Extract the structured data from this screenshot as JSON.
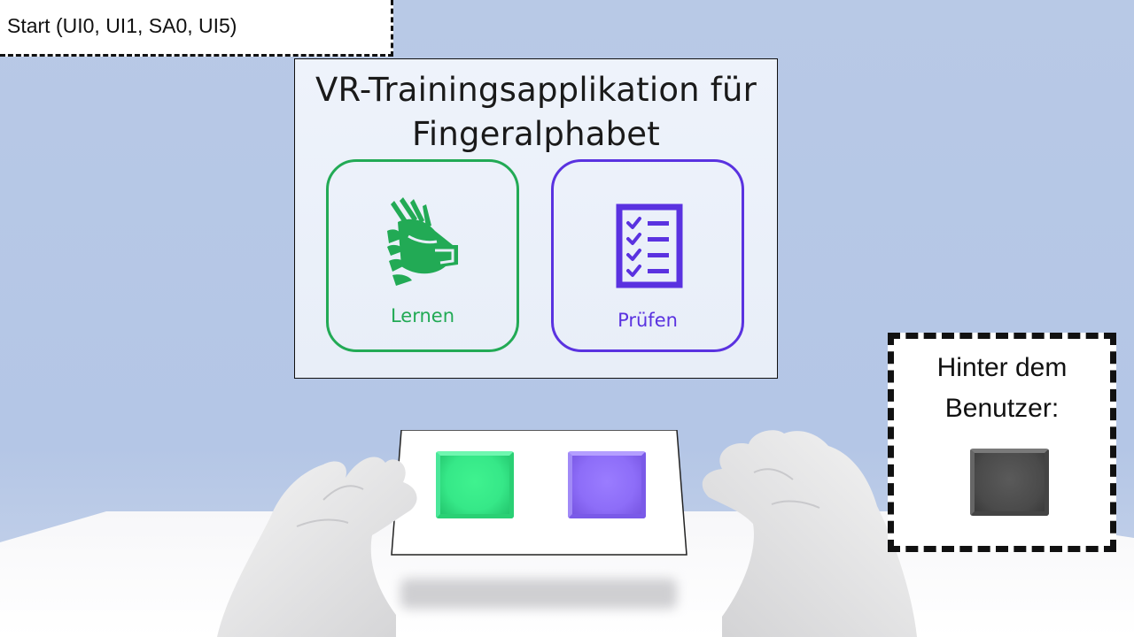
{
  "scene_label": "Start (UI0, UI1, SA0, UI5)",
  "menu": {
    "title_line1": "VR-Trainingsapplikation für",
    "title_line2": "Fingeralphabet",
    "options": [
      {
        "label": "Lernen",
        "icon": "sign-language-hands-icon",
        "color": "#22aa55"
      },
      {
        "label": "Prüfen",
        "icon": "checklist-icon",
        "color": "#5a32e0"
      }
    ]
  },
  "behind_user": {
    "line1": "Hinter dem",
    "line2": "Benutzer:",
    "button_color": "#4a4a4a"
  },
  "buttons": [
    {
      "name": "learn",
      "color": "#36e888"
    },
    {
      "name": "test",
      "color": "#8d6df8"
    }
  ]
}
